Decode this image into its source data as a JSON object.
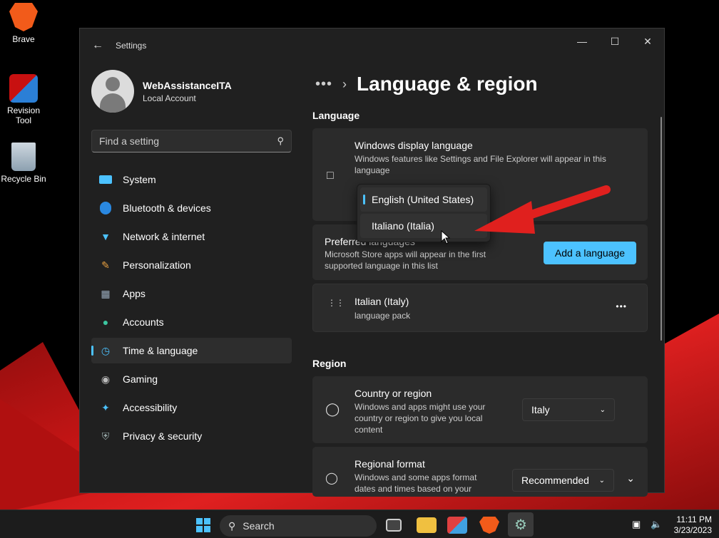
{
  "desktop": {
    "icons": [
      {
        "label": "Brave",
        "icon": "brave-icon"
      },
      {
        "label": "Revision Tool",
        "icon": "revision-tool-icon"
      },
      {
        "label": "Recycle Bin",
        "icon": "recycle-bin-icon"
      }
    ]
  },
  "window": {
    "title": "Settings",
    "controls": [
      "minimize",
      "maximize",
      "close"
    ]
  },
  "profile": {
    "name": "WebAssistanceITA",
    "type": "Local Account"
  },
  "search": {
    "placeholder": "Find a setting"
  },
  "nav": [
    {
      "label": "System",
      "icon": "system-icon"
    },
    {
      "label": "Bluetooth & devices",
      "icon": "bluetooth-icon"
    },
    {
      "label": "Network & internet",
      "icon": "wifi-icon"
    },
    {
      "label": "Personalization",
      "icon": "brush-icon"
    },
    {
      "label": "Apps",
      "icon": "apps-icon"
    },
    {
      "label": "Accounts",
      "icon": "accounts-icon"
    },
    {
      "label": "Time & language",
      "icon": "time-language-icon",
      "selected": true
    },
    {
      "label": "Gaming",
      "icon": "gaming-icon"
    },
    {
      "label": "Accessibility",
      "icon": "accessibility-icon"
    },
    {
      "label": "Privacy & security",
      "icon": "shield-icon"
    }
  ],
  "breadcrumb": {
    "dots": "•••",
    "title": "Language & region"
  },
  "language": {
    "section": "Language",
    "display": {
      "title": "Windows display language",
      "desc": "Windows features like Settings and File Explorer will appear in this language",
      "options": [
        "English (United States)",
        "Italiano (Italia)"
      ],
      "selected": "English (United States)"
    },
    "preferred": {
      "title": "Preferred languages",
      "desc": "Microsoft Store apps will appear in the first supported language in this list",
      "button": "Add a language"
    },
    "item": {
      "title": "Italian (Italy)",
      "desc": "language pack",
      "more": "•••"
    }
  },
  "region": {
    "section": "Region",
    "country": {
      "title": "Country or region",
      "desc": "Windows and apps might use your country or region to give you local content",
      "value": "Italy"
    },
    "format": {
      "title": "Regional format",
      "desc": "Windows and some apps format dates and times based on your",
      "value": "Recommended"
    }
  },
  "taskbar": {
    "search": "Search",
    "time": "11:11 PM",
    "date": "3/23/2023"
  },
  "colors": {
    "accent": "#4cc2ff",
    "arrow": "#e0201e"
  }
}
